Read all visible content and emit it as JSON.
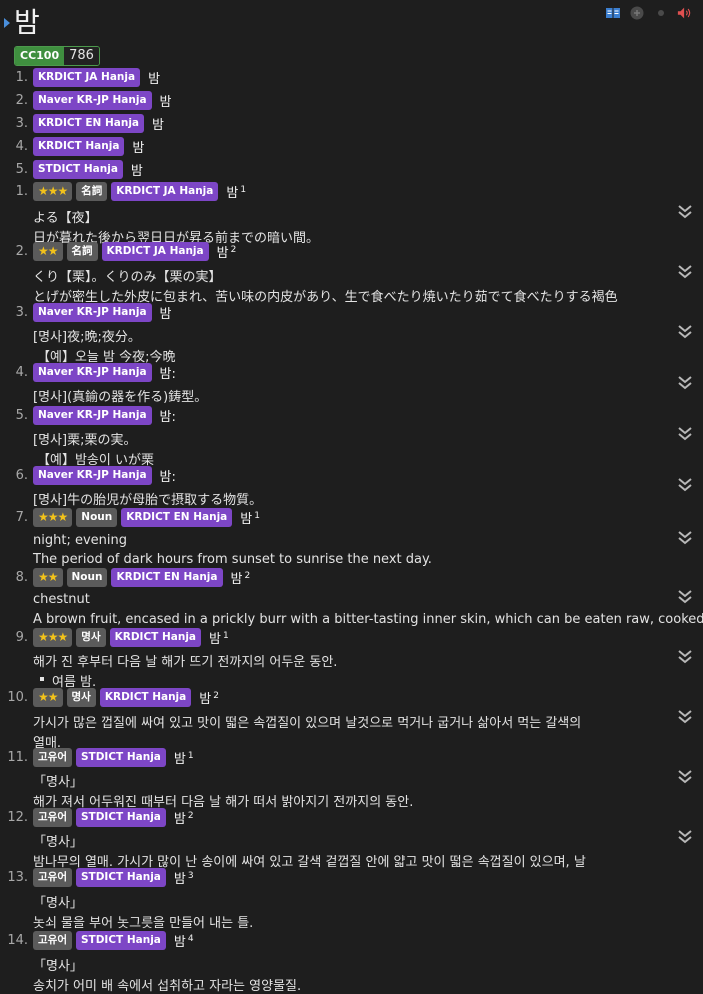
{
  "header": {
    "term": "밤"
  },
  "frequency": {
    "name": "CC100",
    "value": "786"
  },
  "pronunciations": [
    {
      "num": "1.",
      "dict": "KRDICT JA Hanja",
      "reading": "밤"
    },
    {
      "num": "2.",
      "dict": "Naver KR-JP Hanja",
      "reading": "밤"
    },
    {
      "num": "3.",
      "dict": "KRDICT EN Hanja",
      "reading": "밤"
    },
    {
      "num": "4.",
      "dict": "KRDICT Hanja",
      "reading": "밤"
    },
    {
      "num": "5.",
      "dict": "STDICT Hanja",
      "reading": "밤"
    }
  ],
  "entries": [
    {
      "num": "1.",
      "stars": "★★★",
      "pos": "名詞",
      "dict": "KRDICT JA Hanja",
      "hw": "밤",
      "sup": "1",
      "lines": [
        "よる【夜】",
        "日が暮れた後から翌日日が昇る前までの暗い間。"
      ]
    },
    {
      "num": "2.",
      "stars": "★★",
      "pos": "名詞",
      "dict": "KRDICT JA Hanja",
      "hw": "밤",
      "sup": "2",
      "lines": [
        "くり【栗】。くりのみ【栗の実】",
        "とげが密生した外皮に包まれ、苦い味の内皮があり、生で食べたり焼いたり茹でて食べたりする褐色"
      ]
    },
    {
      "num": "3.",
      "stars": "",
      "pos": "",
      "dict": "Naver KR-JP Hanja",
      "hw": "밤",
      "sup": "",
      "lines": [
        "[명사]夜;晩;夜分。",
        "【예】오늘 밤 今夜;今晩"
      ]
    },
    {
      "num": "4.",
      "stars": "",
      "pos": "",
      "dict": "Naver KR-JP Hanja",
      "hw": "밤:",
      "sup": "",
      "lines": [
        "[명사](真鍮の器を作る)鋳型。"
      ]
    },
    {
      "num": "5.",
      "stars": "",
      "pos": "",
      "dict": "Naver KR-JP Hanja",
      "hw": "밤:",
      "sup": "",
      "lines": [
        "[명사]栗;栗の実。",
        "【예】밤송이 いが栗"
      ]
    },
    {
      "num": "6.",
      "stars": "",
      "pos": "",
      "dict": "Naver KR-JP Hanja",
      "hw": "밤:",
      "sup": "",
      "lines": [
        "[명사]牛の胎児が母胎で摂取する物質。"
      ]
    },
    {
      "num": "7.",
      "stars": "★★★",
      "pos": "Noun",
      "dict": "KRDICT EN Hanja",
      "hw": "밤",
      "sup": "1",
      "lines": [
        "night; evening",
        "The period of dark hours from sunset to sunrise the next day."
      ]
    },
    {
      "num": "8.",
      "stars": "★★",
      "pos": "Noun",
      "dict": "KRDICT EN Hanja",
      "hw": "밤",
      "sup": "2",
      "lines": [
        "chestnut",
        "A brown fruit, encased in a prickly burr with a bitter-tasting inner skin, which can be eaten raw, cooked"
      ]
    },
    {
      "num": "9.",
      "stars": "★★★",
      "pos": "명사",
      "dict": "KRDICT Hanja",
      "hw": "밤",
      "sup": "1",
      "lines": [
        "해가 진 후부터 다음 날 해가 뜨기 전까지의 어두운 동안."
      ],
      "bullet": "여름 밤."
    },
    {
      "num": "10.",
      "stars": "★★",
      "pos": "명사",
      "dict": "KRDICT Hanja",
      "hw": "밤",
      "sup": "2",
      "lines": [
        "가시가 많은 껍질에 싸여 있고 맛이 떫은 속껍질이 있으며 날것으로 먹거나 굽거나 삶아서 먹는 갈색의",
        "열매."
      ]
    },
    {
      "num": "11.",
      "stars": "",
      "pos": "고유어",
      "dict": "STDICT Hanja",
      "hw": "밤",
      "sup": "1",
      "lines": [
        "「명사」",
        "해가 져서 어두워진 때부터 다음 날 해가 떠서 밝아지기 전까지의 동안."
      ]
    },
    {
      "num": "12.",
      "stars": "",
      "pos": "고유어",
      "dict": "STDICT Hanja",
      "hw": "밤",
      "sup": "2",
      "lines": [
        "「명사」",
        "밤나무의 열매. 가시가 많이 난 송이에 싸여 있고 갈색 겉껍질 안에 얇고 맛이 떫은 속껍질이 있으며, 날"
      ]
    },
    {
      "num": "13.",
      "stars": "",
      "pos": "고유어",
      "dict": "STDICT Hanja",
      "hw": "밤",
      "sup": "3",
      "lines": [
        "「명사」",
        "놋쇠 물을 부어 놋그릇을 만들어 내는 틀."
      ]
    },
    {
      "num": "14.",
      "stars": "",
      "pos": "고유어",
      "dict": "STDICT Hanja",
      "hw": "밤",
      "sup": "4",
      "lines": [
        "「명사」",
        "송치가 어미 배 속에서 섭취하고 자라는 영양물질."
      ]
    }
  ],
  "colors": {
    "background": "#1e1e1e",
    "dict_tag": "#7d46c6",
    "pos_tag": "#5b5b5b",
    "freq": "#3f8f3f",
    "star": "#f2c21b"
  },
  "icons": [
    "book-icon",
    "add-note-icon",
    "status-dot-icon",
    "audio-icon",
    "chevron-double-down-icon"
  ]
}
